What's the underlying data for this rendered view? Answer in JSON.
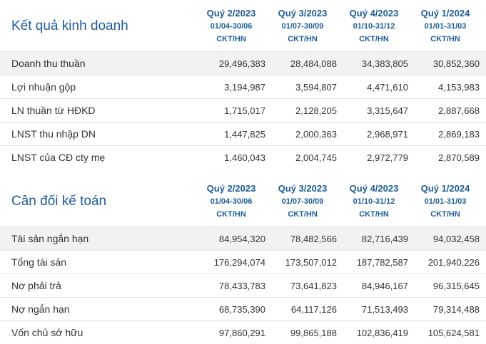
{
  "income": {
    "title": "Kết quả kinh doanh",
    "periods": [
      {
        "quarter": "Quý 2/2023",
        "range": "01/04-30/06",
        "unit": "CKT/HN"
      },
      {
        "quarter": "Quý 3/2023",
        "range": "01/07-30/09",
        "unit": "CKT/HN"
      },
      {
        "quarter": "Quý 4/2023",
        "range": "01/10-31/12",
        "unit": "CKT/HN"
      },
      {
        "quarter": "Quý 1/2024",
        "range": "01/01-31/03",
        "unit": "CKT/HN"
      }
    ],
    "rows": [
      {
        "label": "Doanh thu thuần",
        "values": [
          "29,496,383",
          "28,484,088",
          "34,383,805",
          "30,852,360"
        ]
      },
      {
        "label": "Lợi nhuận gộp",
        "values": [
          "3,194,987",
          "3,594,807",
          "4,471,610",
          "4,153,983"
        ]
      },
      {
        "label": "LN thuần từ HĐKD",
        "values": [
          "1,715,017",
          "2,128,205",
          "3,315,647",
          "2,887,668"
        ]
      },
      {
        "label": "LNST thu nhập DN",
        "values": [
          "1,447,825",
          "2,000,363",
          "2,968,971",
          "2,869,183"
        ]
      },
      {
        "label": "LNST của CĐ cty mẹ",
        "values": [
          "1,460,043",
          "2,004,745",
          "2,972,779",
          "2,870,589"
        ]
      }
    ]
  },
  "balance": {
    "title": "Cân đối kế toán",
    "periods": [
      {
        "quarter": "Quý 2/2023",
        "range": "01/04-30/06",
        "unit": "CKT/HN"
      },
      {
        "quarter": "Quý 3/2023",
        "range": "01/07-30/09",
        "unit": "CKT/HN"
      },
      {
        "quarter": "Quý 4/2023",
        "range": "01/10-31/12",
        "unit": "CKT/HN"
      },
      {
        "quarter": "Quý 1/2024",
        "range": "01/01-31/03",
        "unit": "CKT/HN"
      }
    ],
    "rows": [
      {
        "label": "Tài sản ngắn hạn",
        "values": [
          "84,954,320",
          "78,482,566",
          "82,716,439",
          "94,032,458"
        ]
      },
      {
        "label": "Tổng tài sản",
        "values": [
          "176,294,074",
          "173,507,012",
          "187,782,587",
          "201,940,226"
        ]
      },
      {
        "label": "Nợ phải trả",
        "values": [
          "78,433,783",
          "73,641,823",
          "84,946,167",
          "96,315,645"
        ]
      },
      {
        "label": "Nợ ngắn hạn",
        "values": [
          "68,735,390",
          "64,117,126",
          "71,513,493",
          "79,314,488"
        ]
      },
      {
        "label": "Vốn chủ sở hữu",
        "values": [
          "97,860,291",
          "99,865,188",
          "102,836,419",
          "105,624,581"
        ]
      }
    ]
  }
}
